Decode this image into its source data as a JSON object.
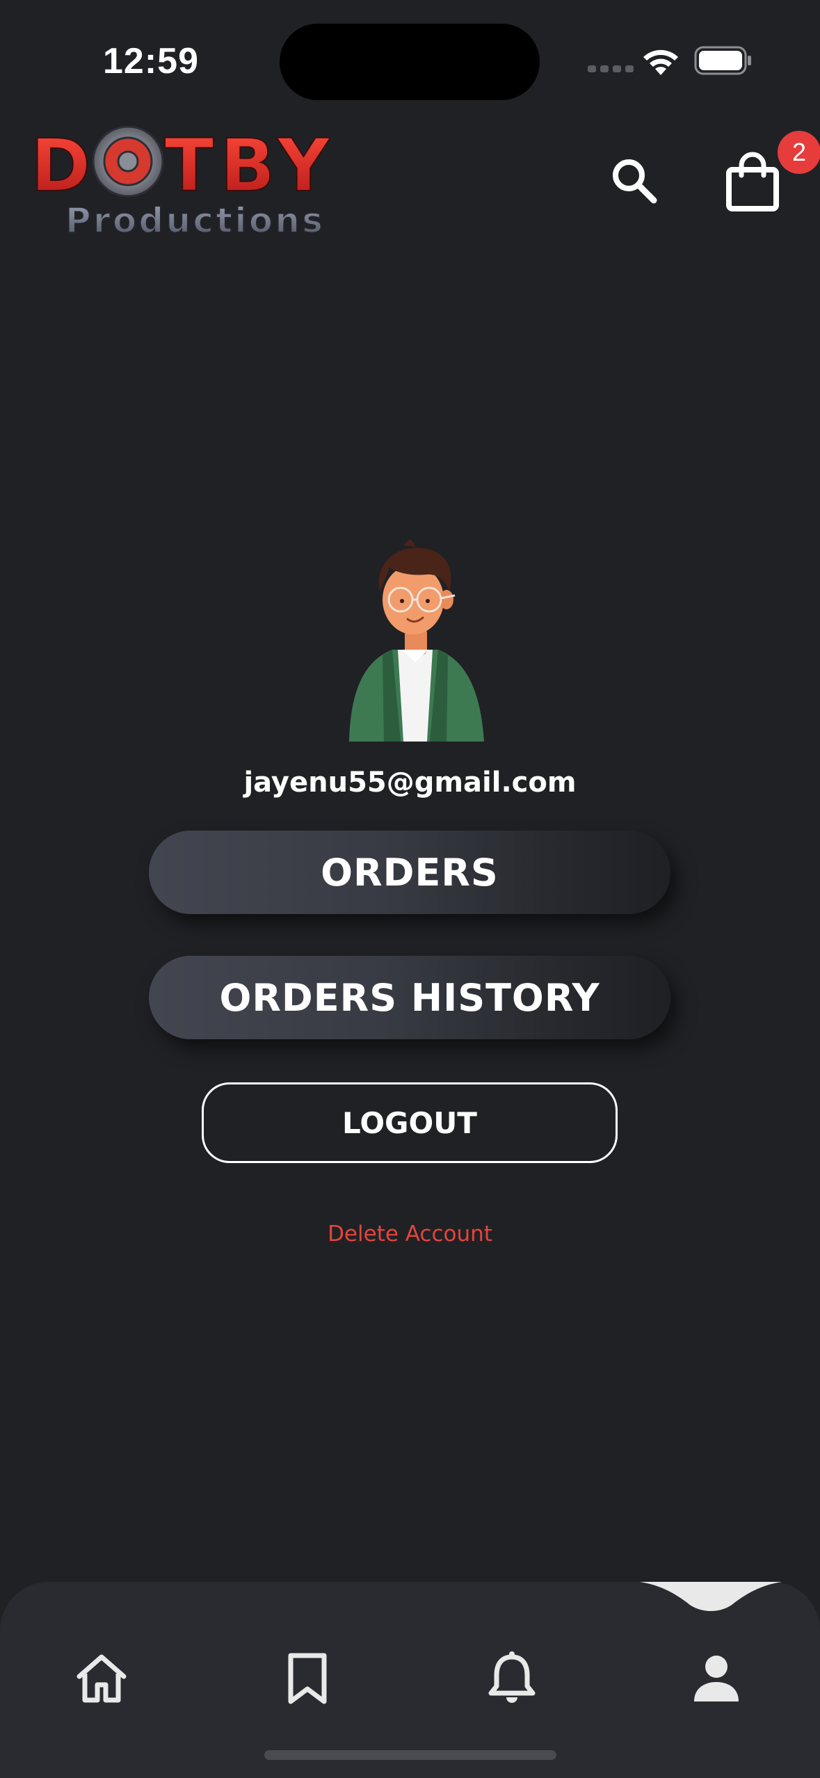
{
  "status_bar": {
    "time": "12:59"
  },
  "header": {
    "logo_top": "DOTBY",
    "logo_bottom": "Productions",
    "cart_count": "2"
  },
  "profile": {
    "email": "jayenu55@gmail.com"
  },
  "actions": {
    "orders_label": "ORDERS",
    "orders_history_label": "ORDERS HISTORY",
    "logout_label": "LOGOUT",
    "delete_account_label": "Delete Account"
  },
  "bottom_nav": {
    "items": [
      {
        "icon": "home-icon"
      },
      {
        "icon": "bookmark-icon"
      },
      {
        "icon": "bell-icon"
      },
      {
        "icon": "person-icon",
        "active": true
      }
    ]
  },
  "colors": {
    "background": "#202125",
    "nav_background": "#2a2b30",
    "badge": "#e63c3c",
    "delete_text": "#e2453c",
    "logo_red": "#e03030"
  }
}
